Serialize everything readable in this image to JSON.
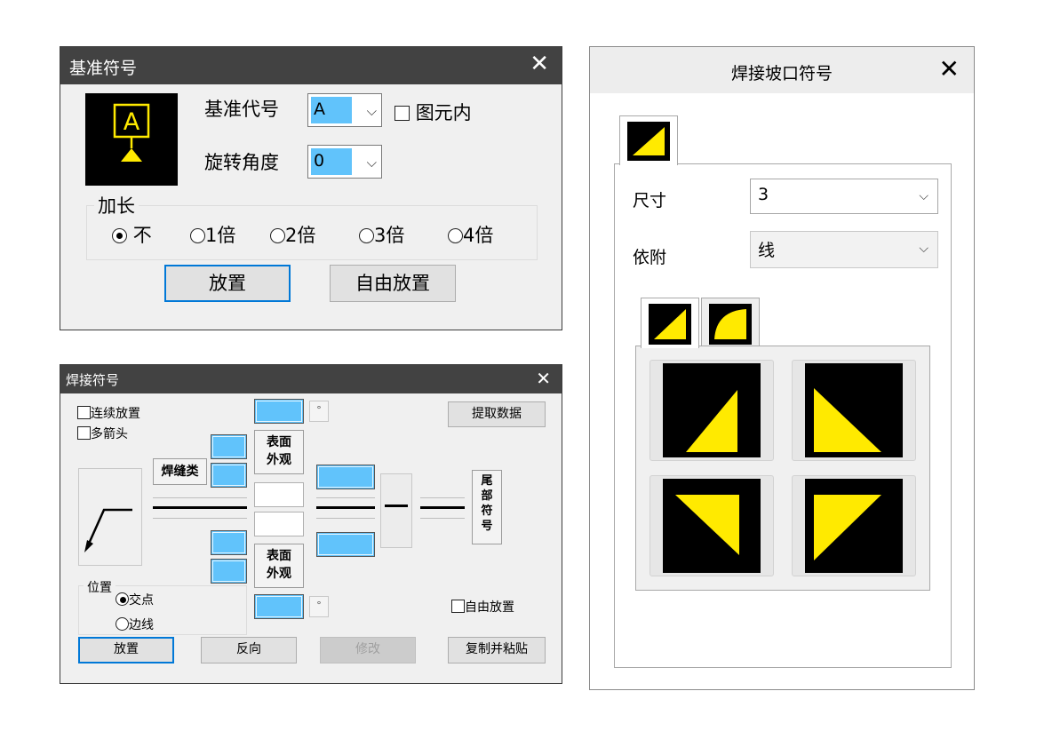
{
  "datum_dialog": {
    "title": "基准符号",
    "close": "✕",
    "preview_letter": "A",
    "code_label": "基准代号",
    "code_value": "A",
    "in_frame_label": "图元内",
    "rotation_label": "旋转角度",
    "rotation_value": "0",
    "extend_group": "加长",
    "extend_options": [
      "不",
      "1倍",
      "2倍",
      "3倍",
      "4倍"
    ],
    "extend_selected": "不",
    "place_button": "放置",
    "free_place_button": "自由放置"
  },
  "weld_dialog": {
    "title": "焊接符号",
    "close": "✕",
    "continuous_label": "连续放置",
    "multi_arrow_label": "多箭头",
    "extract_button": "提取数据",
    "weld_type_button": "焊缝类",
    "surface_top_button": "表面\n外观",
    "surface_bottom_button": "表面\n外观",
    "tail_button": "尾\n部\n符\n号",
    "degree_symbol": "°",
    "position_group": "位置",
    "position_options": [
      "交点",
      "边线"
    ],
    "position_selected": "交点",
    "free_place_label": "自由放置",
    "buttons": {
      "place": "放置",
      "reverse": "反向",
      "modify": "修改",
      "copy_paste": "复制并粘贴"
    }
  },
  "bevel_dialog": {
    "title": "焊接坡口符号",
    "close": "✕",
    "size_label": "尺寸",
    "size_value": "3",
    "attach_label": "依附",
    "attach_value": "线",
    "icons": [
      "triangle-left",
      "triangle-right",
      "triangle-down-left",
      "triangle-down-right"
    ]
  },
  "colors": {
    "symbol_yellow": "#ffea00",
    "field_blue": "#61c3fb",
    "focus_blue": "#0078d7",
    "titlebar_dark": "#424242"
  }
}
